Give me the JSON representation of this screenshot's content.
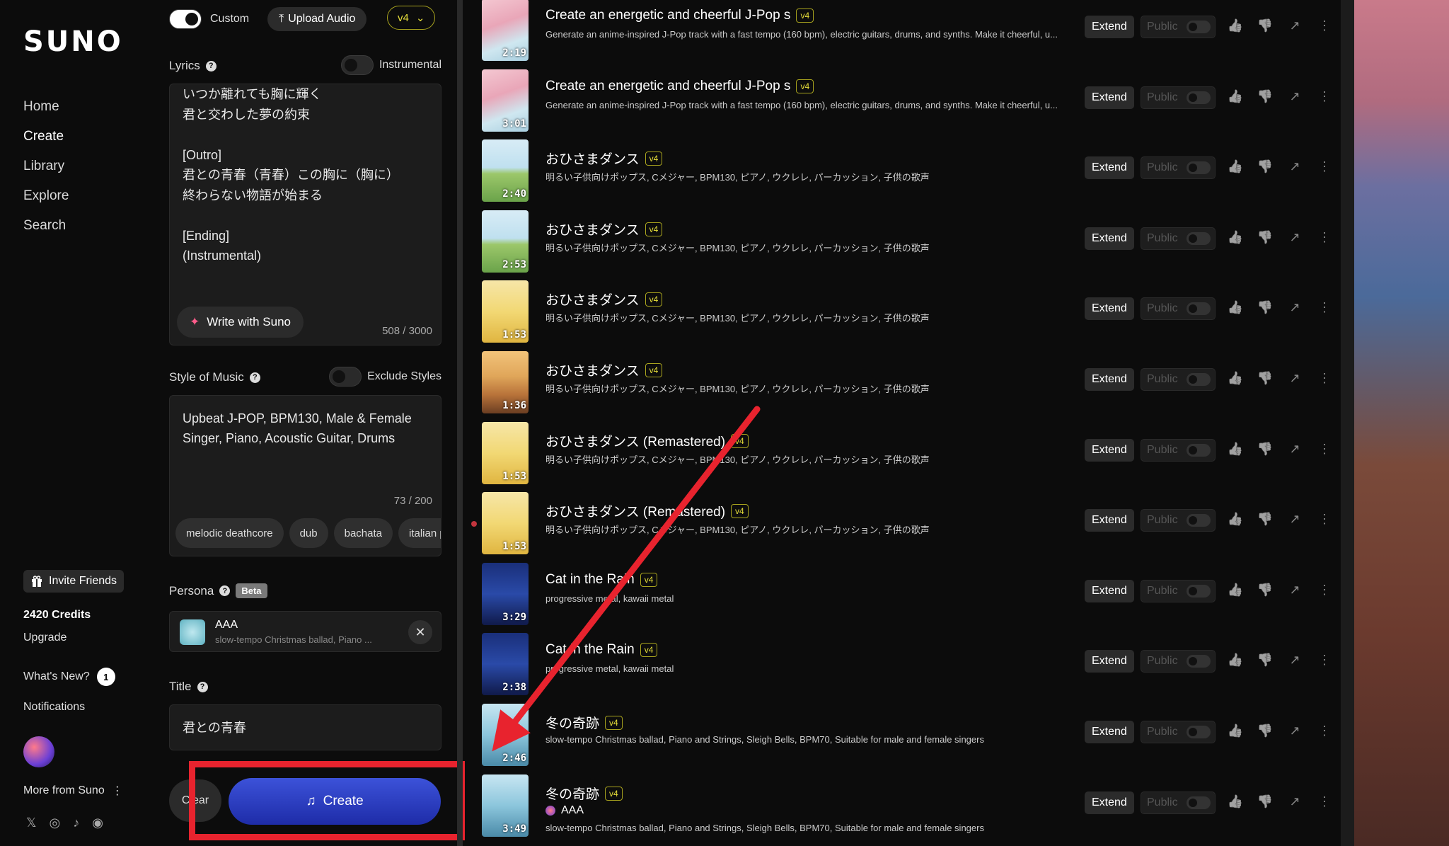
{
  "sidebar": {
    "logo": "SUNO",
    "nav": [
      "Home",
      "Create",
      "Library",
      "Explore",
      "Search"
    ],
    "invite": "Invite Friends",
    "credits": "2420 Credits",
    "upgrade": "Upgrade",
    "whats_new": "What's New?",
    "whats_new_count": "1",
    "notifications": "Notifications",
    "more": "More from Suno"
  },
  "create": {
    "custom_label": "Custom",
    "upload_label": "Upload Audio",
    "version": "v4",
    "lyrics_label": "Lyrics",
    "instrumental_label": "Instrumental",
    "lyrics_text": "いつか離れても胸に輝く\n君と交わした夢の約束\n\n[Outro]\n君との青春（青春）この胸に（胸に）\n終わらない物語が始まる\n\n[Ending]\n(Instrumental)",
    "write_with_suno": "Write with Suno",
    "lyrics_count": "508 / 3000",
    "style_label": "Style of Music",
    "exclude_label": "Exclude Styles",
    "style_text": "Upbeat J-POP, BPM130, Male & Female Singer, Piano, Acoustic Guitar, Drums",
    "style_count": "73 / 200",
    "chips": [
      "melodic deathcore",
      "dub",
      "bachata",
      "italian p"
    ],
    "persona_label": "Persona",
    "beta": "Beta",
    "persona_name": "AAA",
    "persona_desc": "slow-tempo Christmas ballad, Piano ...",
    "title_label": "Title",
    "title_value": "君との青春",
    "clear_label": "Clear",
    "create_label": "Create"
  },
  "song_actions": {
    "extend": "Extend",
    "public": "Public"
  },
  "songs": [
    {
      "title": "Create an energetic and cheerful J-Pop s",
      "version": "v4",
      "desc": "Generate an anime-inspired J-Pop track with a fast tempo (160 bpm), electric guitars, drums, and synths. Make it cheerful, u...",
      "duration": "2:19",
      "thumb": "blossom"
    },
    {
      "title": "Create an energetic and cheerful J-Pop s",
      "version": "v4",
      "desc": "Generate an anime-inspired J-Pop track with a fast tempo (160 bpm), electric guitars, drums, and synths. Make it cheerful, u...",
      "duration": "3:01",
      "thumb": "blossom"
    },
    {
      "title": "おひさまダンス",
      "version": "v4",
      "desc": "明るい子供向けポップス, Cメジャー, BPM130, ピアノ, ウクレレ, パーカッション, 子供の歌声",
      "duration": "2:40",
      "thumb": "meadow"
    },
    {
      "title": "おひさまダンス",
      "version": "v4",
      "desc": "明るい子供向けポップス, Cメジャー, BPM130, ピアノ, ウクレレ, パーカッション, 子供の歌声",
      "duration": "2:53",
      "thumb": "meadow"
    },
    {
      "title": "おひさまダンス",
      "version": "v4",
      "desc": "明るい子供向けポップス, Cメジャー, BPM130, ピアノ, ウクレレ, パーカッション, 子供の歌声",
      "duration": "1:53",
      "thumb": "balloons"
    },
    {
      "title": "おひさまダンス",
      "version": "v4",
      "desc": "明るい子供向けポップス, Cメジャー, BPM130, ピアノ, ウクレレ, パーカッション, 子供の歌声",
      "duration": "1:36",
      "thumb": "autumn"
    },
    {
      "title": "おひさまダンス (Remastered)",
      "version": "v4",
      "desc": "明るい子供向けポップス, Cメジャー, BPM130, ピアノ, ウクレレ, パーカッション, 子供の歌声",
      "duration": "1:53",
      "thumb": "balloons"
    },
    {
      "title": "おひさまダンス (Remastered)",
      "version": "v4",
      "desc": "明るい子供向けポップス, Cメジャー, BPM130, ピアノ, ウクレレ, パーカッション, 子供の歌声",
      "duration": "1:53",
      "thumb": "balloons"
    },
    {
      "title": "Cat in the Rain",
      "version": "v4",
      "desc": "progressive metal, kawaii metal",
      "duration": "3:29",
      "thumb": "night"
    },
    {
      "title": "Cat in the Rain",
      "version": "v4",
      "desc": "progressive metal, kawaii metal",
      "duration": "2:38",
      "thumb": "night"
    },
    {
      "title": "冬の奇跡",
      "version": "v4",
      "desc": "slow-tempo Christmas ballad, Piano and Strings, Sleigh Bells, BPM70, Suitable for male and female singers",
      "duration": "2:46",
      "thumb": "winter"
    },
    {
      "title": "冬の奇跡",
      "version": "v4",
      "desc": "slow-tempo Christmas ballad, Piano and Strings, Sleigh Bells, BPM70, Suitable for male and female singers",
      "duration": "3:49",
      "thumb": "winter",
      "persona": "AAA"
    }
  ],
  "colors": {
    "accent_version": "#e6de3a",
    "highlight": "#e8232e",
    "create_button": "#2a3cc4"
  }
}
